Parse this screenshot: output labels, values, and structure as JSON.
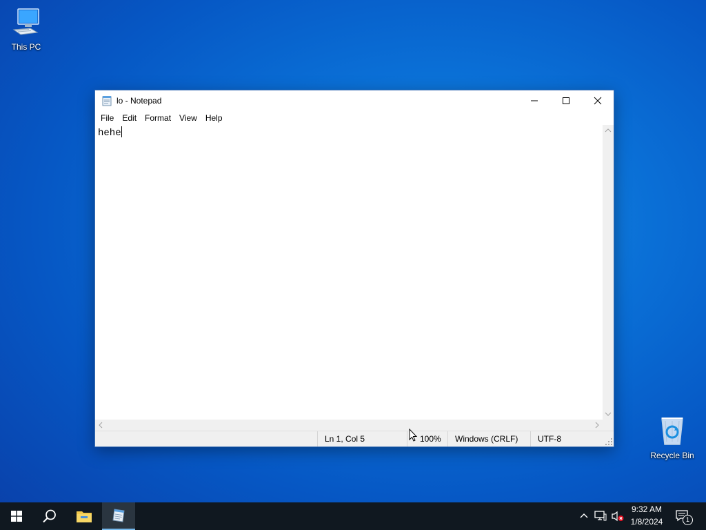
{
  "desktop": {
    "icons": [
      {
        "label": "This PC"
      },
      {
        "label": "Recycle Bin"
      }
    ]
  },
  "window": {
    "title": "lo - Notepad",
    "menu": [
      "File",
      "Edit",
      "Format",
      "View",
      "Help"
    ],
    "content": "hehe",
    "status": {
      "position": "Ln 1, Col 5",
      "zoom": "100%",
      "line_ending": "Windows (CRLF)",
      "encoding": "UTF-8"
    }
  },
  "taskbar": {
    "clock_time": "9:32 AM",
    "clock_date": "1/8/2024",
    "notification_count": "1",
    "icons": [
      "windows-start-icon",
      "search-icon",
      "file-explorer-icon",
      "notepad-icon"
    ]
  },
  "colors": {
    "accent": "#0078d7",
    "taskbar_bg": "#101820"
  }
}
